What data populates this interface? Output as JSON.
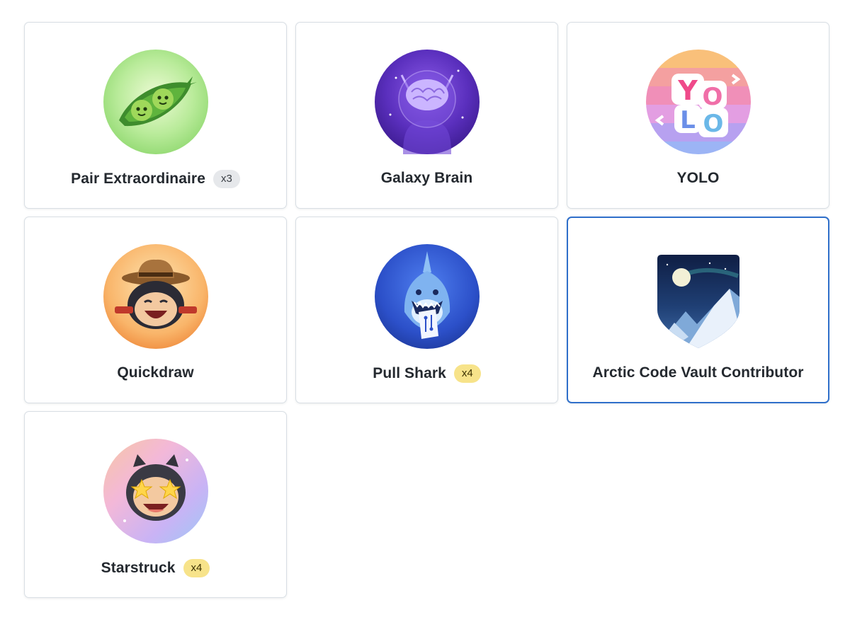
{
  "achievements": [
    {
      "name": "Pair Extraordinaire",
      "count": "x3",
      "count_style": "grey",
      "icon": "pea-pod-icon"
    },
    {
      "name": "Galaxy Brain",
      "count": "",
      "icon": "galaxy-brain-icon"
    },
    {
      "name": "YOLO",
      "count": "",
      "icon": "yolo-icon"
    },
    {
      "name": "Quickdraw",
      "count": "",
      "icon": "quickdraw-cowboy-icon"
    },
    {
      "name": "Pull Shark",
      "count": "x4",
      "count_style": "gold",
      "icon": "pull-shark-icon"
    },
    {
      "name": "Arctic Code Vault Contributor",
      "count": "",
      "icon": "arctic-vault-shield-icon",
      "selected": true
    },
    {
      "name": "Starstruck",
      "count": "x4",
      "count_style": "gold",
      "icon": "starstruck-octocat-icon"
    }
  ],
  "colors": {
    "selected_border": "#2f6fca",
    "gold_count_bg": "#f7e38a",
    "grey_count_bg": "#e6e8eb"
  }
}
